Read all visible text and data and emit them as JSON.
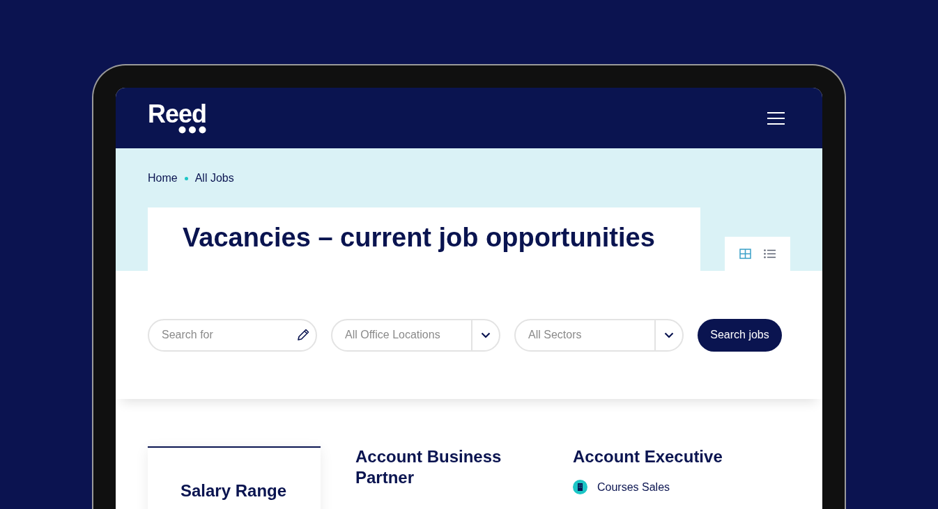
{
  "header": {
    "logo": "Reed"
  },
  "breadcrumb": [
    "Home",
    "All Jobs"
  ],
  "title": "Vacancies – current job opportunities",
  "view_toggle": [
    {
      "kind": "grid",
      "selected": true
    },
    {
      "kind": "list",
      "selected": false
    }
  ],
  "search": {
    "keyword": {
      "placeholder": "Search for"
    },
    "location": {
      "placeholder": "All Office Locations"
    },
    "sector": {
      "placeholder": "All Sectors"
    },
    "button": "Search jobs"
  },
  "filters": {
    "heading": "Salary Range"
  },
  "jobs": [
    {
      "title": "Account Business Partner"
    },
    {
      "title": "Account Executive",
      "details": [
        "Courses Sales"
      ]
    }
  ]
}
